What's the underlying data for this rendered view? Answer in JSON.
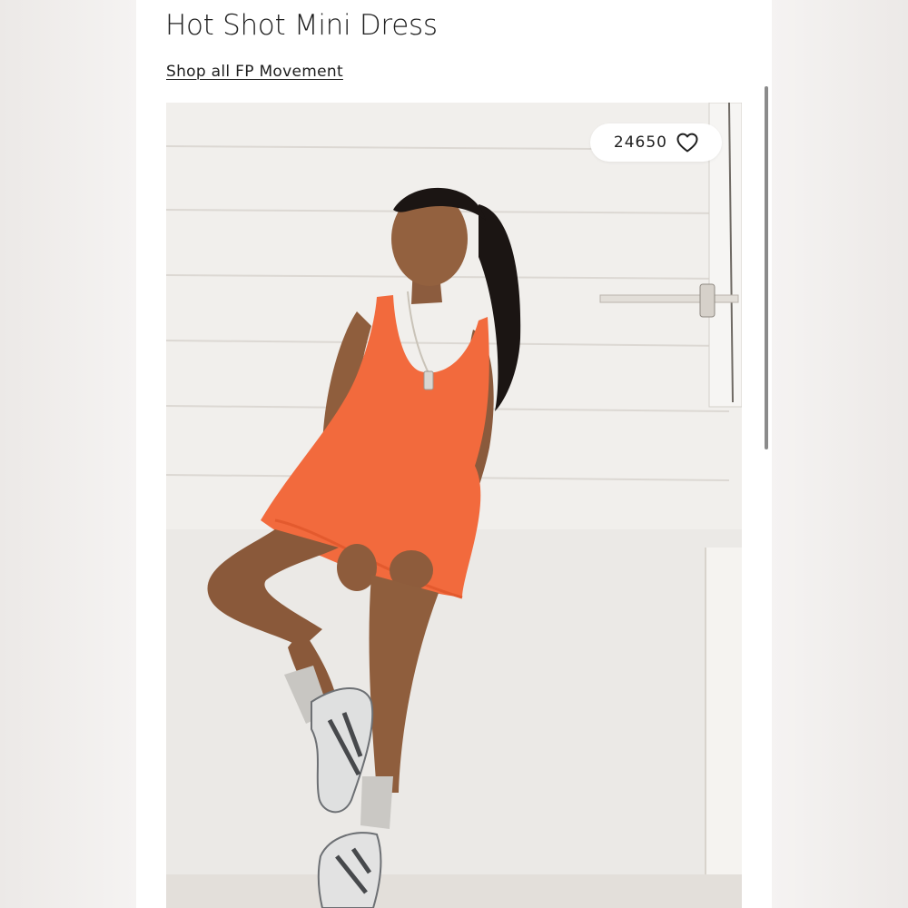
{
  "product": {
    "title": "Hot Shot Mini Dress",
    "shop_link": "Shop all FP Movement"
  },
  "photo": {
    "like_count": "24650",
    "like_icon": "heart-outline-icon",
    "dress_color": "#f26a3d",
    "wall_color": "#f1efec"
  }
}
